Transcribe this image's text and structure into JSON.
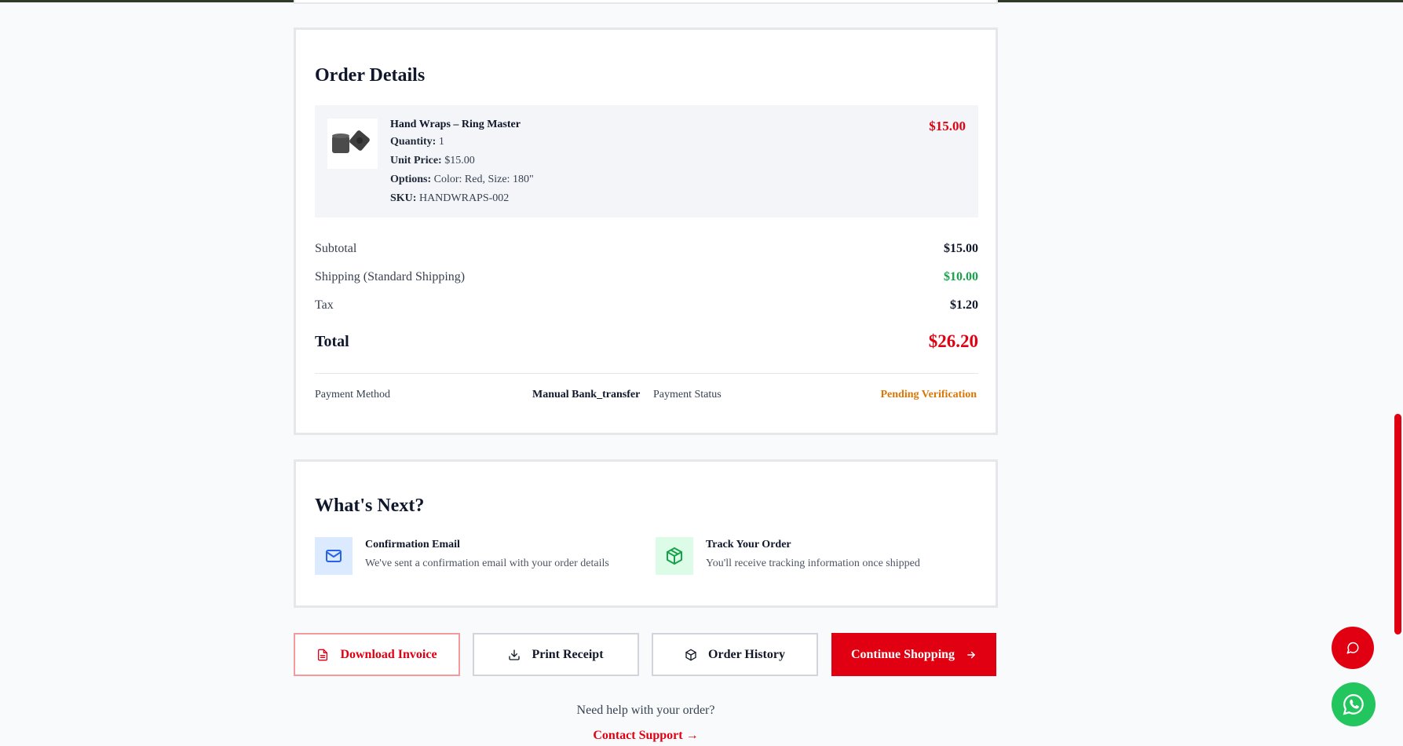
{
  "order": {
    "title": "Order Details",
    "item": {
      "name": "Hand Wraps – Ring Master",
      "quantity_label": "Quantity:",
      "quantity": "1",
      "unit_price_label": "Unit Price:",
      "unit_price": "$15.00",
      "options_label": "Options:",
      "options": "Color: Red, Size: 180\"",
      "sku_label": "SKU:",
      "sku": "HANDWRAPS-002",
      "price": "$15.00"
    },
    "summary": {
      "subtotal_label": "Subtotal",
      "subtotal": "$15.00",
      "shipping_label": "Shipping (Standard Shipping)",
      "shipping": "$10.00",
      "tax_label": "Tax",
      "tax": "$1.20",
      "total_label": "Total",
      "total": "$26.20"
    },
    "payment": {
      "method_label": "Payment Method",
      "method": "Manual Bank_transfer",
      "status_label": "Payment Status",
      "status": "Pending Verification"
    }
  },
  "next": {
    "title": "What's Next?",
    "items": [
      {
        "icon": "mail-icon",
        "title": "Confirmation Email",
        "desc": "We've sent a confirmation email with your order details"
      },
      {
        "icon": "package-icon",
        "title": "Track Your Order",
        "desc": "You'll receive tracking information once shipped"
      }
    ]
  },
  "actions": {
    "download_invoice": "Download Invoice",
    "print_receipt": "Print Receipt",
    "order_history": "Order History",
    "continue_shopping": "Continue Shopping"
  },
  "help": {
    "text": "Need help with your order?",
    "contact": "Contact Support →"
  },
  "colors": {
    "accent": "#e00012",
    "success": "#16a34a",
    "pending": "#d97706"
  }
}
